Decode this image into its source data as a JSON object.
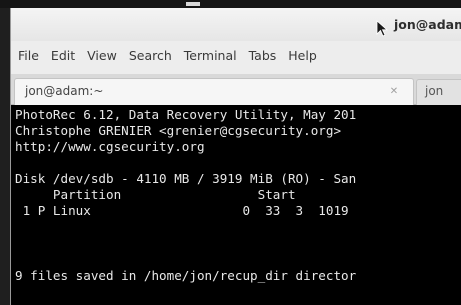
{
  "window": {
    "title": "jon@adam"
  },
  "menubar": {
    "items": [
      "File",
      "Edit",
      "View",
      "Search",
      "Terminal",
      "Tabs",
      "Help"
    ]
  },
  "tabs": {
    "active_label": "jon@adam:~",
    "inactive_label": "jon"
  },
  "terminal": {
    "lines": [
      "PhotoRec 6.12, Data Recovery Utility, May 201",
      "Christophe GRENIER <grenier@cgsecurity.org>",
      "http://www.cgsecurity.org",
      "",
      "Disk /dev/sdb - 4110 MB / 3919 MiB (RO) - San",
      "     Partition                  Start",
      " 1 P Linux                    0  33  3  1019",
      "",
      "",
      "9 files saved in /home/jon/recup_dir director"
    ]
  },
  "icons": {
    "pointer": "mouse-pointer-icon",
    "tab_close": "tab-close-icon"
  },
  "colors": {
    "terminal_bg": "#000000",
    "terminal_fg": "#e8e8e8",
    "window_bg": "#ededed"
  }
}
